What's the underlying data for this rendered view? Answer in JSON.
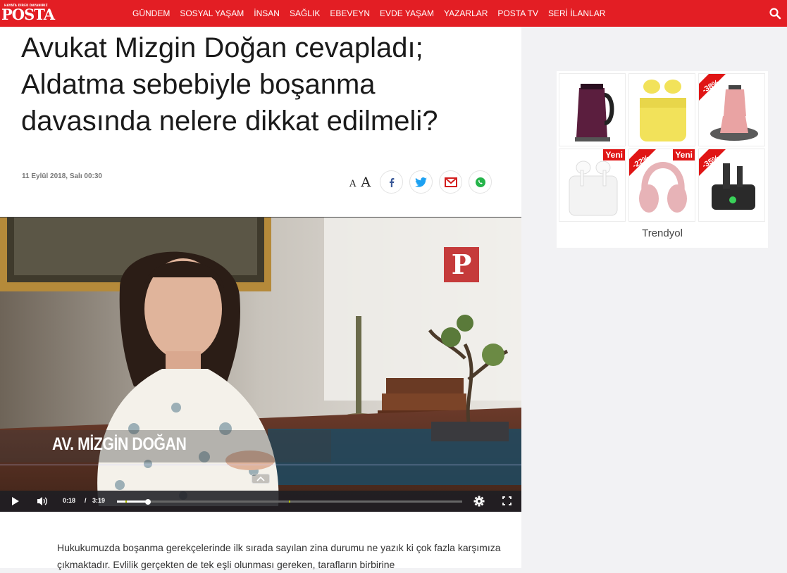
{
  "header": {
    "logo_text": "POSTA",
    "logo_tagline": "HAYATA DİREK DAYANIRIZ",
    "nav": [
      "GÜNDEM",
      "SOSYAL YAŞAM",
      "İNSAN",
      "SAĞLIK",
      "EBEVEYN",
      "EVDE YAŞAM",
      "YAZARLAR",
      "POSTA TV",
      "SERİ İLANLAR"
    ],
    "brand_color": "#e31e24"
  },
  "article": {
    "title": "Avukat Mizgin Doğan cevapladı; Aldatma sebebiyle boşanma davasında nelere dikkat edilmeli?",
    "date": "11 Eylül 2018, Salı 00:30",
    "font_small": "A",
    "font_big": "A",
    "share_icons": [
      "facebook-icon",
      "twitter-icon",
      "mail-icon",
      "whatsapp-icon"
    ],
    "body": "Hukukumuzda boşanma gerekçelerinde ilk sırada sayılan zina durumu ne yazık ki çok fazla karşımıza çıkmaktadır. Evlilik gerçekten de tek eşli olunması gereken, tarafların birbirine"
  },
  "video": {
    "caption": "AV. MİZGİN DOĞAN",
    "channel_logo": "P",
    "current_time": "0:18",
    "separator": "/",
    "duration": "3:19",
    "progress": 0.09
  },
  "ad": {
    "brand": "Trendyol",
    "products": [
      {
        "name": "kettle",
        "badge": ""
      },
      {
        "name": "yellow-earbuds",
        "badge": ""
      },
      {
        "name": "tea-maker",
        "badge": "-38%"
      },
      {
        "name": "white-earbuds",
        "badge": "Yeni"
      },
      {
        "name": "pink-headphones",
        "badge": "-22%",
        "badge2": "Yeni"
      },
      {
        "name": "joystick",
        "badge": "-35%"
      }
    ]
  }
}
